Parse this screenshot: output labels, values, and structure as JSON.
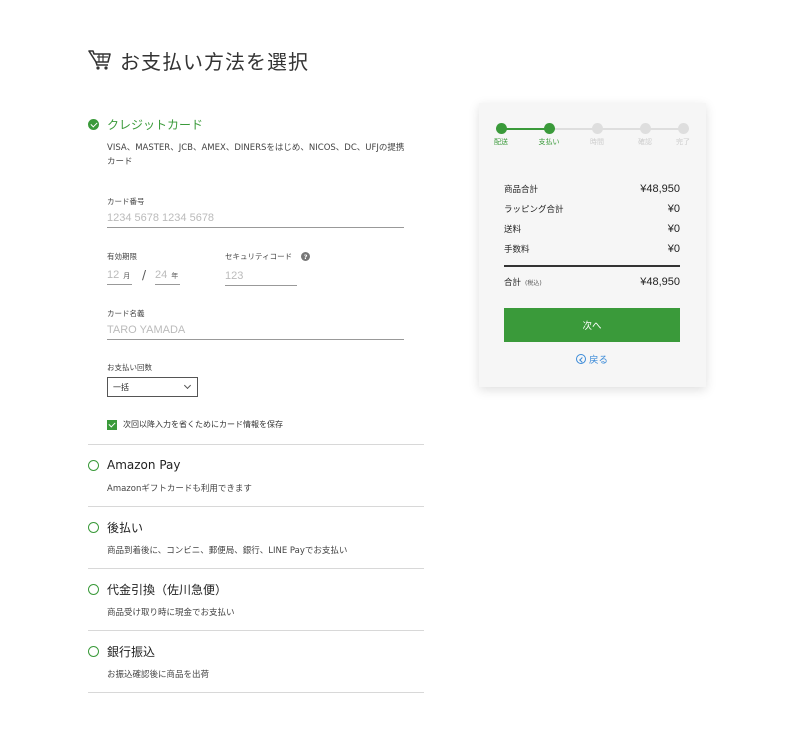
{
  "page": {
    "title": "お支払い方法を選択",
    "icon": "cart-icon",
    "accent_color": "#3a9a3a",
    "link_color": "#3a8ad8"
  },
  "credit": {
    "title": "クレジットカード",
    "description": "VISA、MASTER、JCB、AMEX、DINERSをはじめ、NICOS、DC、UFJの提携カード",
    "card_number_label": "カード番号",
    "card_number_placeholder": "1234 5678 1234 5678",
    "expiry_label": "有効期限",
    "expiry_month_placeholder": "12",
    "expiry_month_unit": "月",
    "expiry_year_placeholder": "24",
    "expiry_year_unit": "年",
    "expiry_separator": "/",
    "security_label": "セキュリティコード",
    "security_help": "?",
    "security_placeholder": "123",
    "name_label": "カード名義",
    "name_placeholder": "TARO YAMADA",
    "installments_label": "お支払い回数",
    "installments_value": "一括",
    "save_label": "次回以降入力を省くためにカード情報を保存",
    "save_checked": true
  },
  "methods": [
    {
      "title": "Amazon Pay",
      "description": "Amazonギフトカードも利用できます"
    },
    {
      "title": "後払い",
      "description": "商品到着後に、コンビニ、郵便局、銀行、LINE Payでお支払い"
    },
    {
      "title": "代金引換（佐川急便）",
      "description": "商品受け取り時に現金でお支払い"
    },
    {
      "title": "銀行振込",
      "description": "お振込確認後に商品を出荷"
    }
  ],
  "steps": [
    {
      "label": "配送",
      "done": true
    },
    {
      "label": "支払い",
      "done": true
    },
    {
      "label": "時間",
      "done": false
    },
    {
      "label": "確認",
      "done": false
    },
    {
      "label": "完了",
      "done": false
    }
  ],
  "summary": {
    "subtotal_label": "商品合計",
    "subtotal": "¥48,950",
    "wrapping_label": "ラッピング合計",
    "wrapping": "¥0",
    "shipping_label": "送料",
    "shipping": "¥0",
    "fee_label": "手数料",
    "fee": "¥0",
    "total_label": "合計",
    "total_note": "(税込)",
    "total": "¥48,950",
    "next_label": "次へ",
    "back_label": "戻る"
  }
}
